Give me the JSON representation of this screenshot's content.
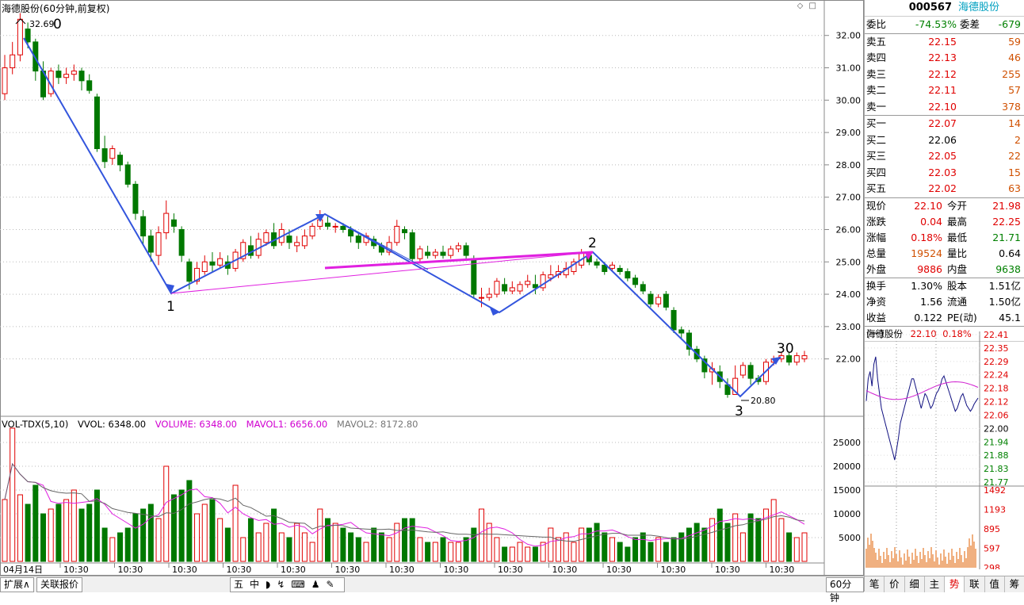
{
  "chart_title": "海德股份(60分钟,前复权)",
  "price_axis": {
    "ticks": [
      "32.00",
      "31.00",
      "30.00",
      "29.00",
      "28.00",
      "27.00",
      "26.00",
      "25.00",
      "24.00",
      "23.00",
      "22.00"
    ],
    "min": 20.3,
    "max": 32.9
  },
  "volume_axis": {
    "ticks": [
      "25000",
      "20000",
      "15000",
      "10000",
      "5000"
    ],
    "max": 28000
  },
  "annotations": {
    "high_label": "32.69",
    "low_label": "20.80",
    "wave0": "0",
    "wave1": "1",
    "wave2": "2",
    "wave3": "3",
    "wave30": "30"
  },
  "vol_header": {
    "name": "VOL-TDX(5,10)",
    "vvol": "VVOL: 6348.00",
    "volume": "VOLUME: 6348.00",
    "mavol1": "MAVOL1: 6656.00",
    "mavol2": "MAVOL2: 8172.80"
  },
  "time_axis": {
    "first": "04月14日",
    "tick": "10:30"
  },
  "bottom_tabs": {
    "expand": "扩展∧",
    "related": "关联报价",
    "period": "60分钟"
  },
  "sidebar": {
    "code": "000567",
    "name": "海德股份",
    "weibi_label": "委比",
    "weibi": "-74.53%",
    "weicha_label": "委差",
    "weicha": "-679",
    "sell": [
      {
        "label": "卖五",
        "price": "22.15",
        "vol": "59"
      },
      {
        "label": "卖四",
        "price": "22.13",
        "vol": "46"
      },
      {
        "label": "卖三",
        "price": "22.12",
        "vol": "255"
      },
      {
        "label": "卖二",
        "price": "22.11",
        "vol": "57"
      },
      {
        "label": "卖一",
        "price": "22.10",
        "vol": "378"
      }
    ],
    "buy": [
      {
        "label": "买一",
        "price": "22.07",
        "vol": "14"
      },
      {
        "label": "买二",
        "price": "22.06",
        "vol": "2"
      },
      {
        "label": "买三",
        "price": "22.05",
        "vol": "22"
      },
      {
        "label": "买四",
        "price": "22.03",
        "vol": "15"
      },
      {
        "label": "买五",
        "price": "22.02",
        "vol": "63"
      }
    ],
    "fund": [
      {
        "a": "现价",
        "b": "22.10",
        "c": "今开",
        "d": "21.98"
      },
      {
        "a": "涨跌",
        "b": "0.04",
        "c": "最高",
        "d": "22.25"
      },
      {
        "a": "涨幅",
        "b": "0.18%",
        "c": "最低",
        "d": "21.71"
      },
      {
        "a": "总量",
        "b": "19524",
        "c": "量比",
        "d": "0.64"
      },
      {
        "a": "外盘",
        "b": "9886",
        "c": "内盘",
        "d": "9638"
      }
    ],
    "fund2": [
      {
        "a": "换手",
        "b": "1.30%",
        "c": "股本",
        "d": "1.51亿"
      },
      {
        "a": "净资",
        "b": "1.56",
        "c": "流通",
        "d": "1.50亿"
      },
      {
        "a": "收益(一)",
        "b": "0.122",
        "c": "PE(动)",
        "d": "45.1"
      }
    ],
    "mini_title": "海德股份",
    "mini_price": "22.10",
    "mini_pct": "0.18%",
    "mini_ticks": [
      "22.41",
      "22.35",
      "22.29",
      "22.24",
      "22.18",
      "22.12",
      "22.06",
      "22.00",
      "21.94",
      "21.88",
      "21.83",
      "21.77"
    ],
    "mini_vol_ticks": [
      "1492",
      "1193",
      "895",
      "597",
      "298"
    ],
    "tabs": [
      "笔",
      "价",
      "细",
      "主",
      "势",
      "联",
      "值",
      "筹"
    ]
  },
  "colors": {
    "up": "#e00000",
    "down": "#007800",
    "wave": "#3355dd",
    "magenta": "#e020e0"
  },
  "chart_data": {
    "type": "candlestick",
    "candles": [
      [
        30.2,
        31.0,
        31.4,
        30.0
      ],
      [
        31.0,
        31.4,
        31.8,
        30.8
      ],
      [
        31.4,
        32.5,
        32.69,
        31.2
      ],
      [
        32.2,
        31.8,
        32.4,
        31.6
      ],
      [
        31.8,
        30.9,
        31.9,
        30.6
      ],
      [
        30.9,
        30.1,
        31.2,
        30.0
      ],
      [
        30.2,
        30.9,
        31.0,
        30.1
      ],
      [
        30.9,
        30.7,
        31.1,
        30.5
      ],
      [
        30.7,
        30.8,
        31.0,
        30.5
      ],
      [
        30.8,
        30.9,
        31.1,
        30.6
      ],
      [
        30.9,
        30.6,
        31.0,
        30.3
      ],
      [
        30.6,
        30.3,
        30.8,
        30.2
      ],
      [
        30.1,
        28.5,
        30.2,
        28.4
      ],
      [
        28.5,
        28.1,
        28.9,
        27.9
      ],
      [
        28.2,
        28.5,
        28.6,
        28.0
      ],
      [
        28.3,
        28.0,
        28.4,
        27.8
      ],
      [
        28.0,
        27.4,
        28.1,
        27.3
      ],
      [
        27.4,
        26.5,
        27.5,
        26.3
      ],
      [
        26.4,
        25.8,
        26.6,
        25.5
      ],
      [
        25.8,
        25.3,
        26.0,
        25.0
      ],
      [
        25.2,
        25.9,
        26.1,
        24.9
      ],
      [
        25.9,
        26.5,
        26.9,
        25.7
      ],
      [
        26.3,
        26.1,
        26.5,
        25.9
      ],
      [
        26.0,
        25.2,
        26.1,
        25.0
      ],
      [
        25.0,
        24.4,
        25.1,
        24.15
      ],
      [
        24.4,
        24.8,
        25.0,
        24.3
      ],
      [
        24.7,
        25.0,
        25.2,
        24.6
      ],
      [
        25.0,
        24.9,
        25.3,
        24.7
      ],
      [
        24.9,
        25.1,
        25.3,
        24.8
      ],
      [
        25.0,
        24.8,
        25.2,
        24.6
      ],
      [
        24.8,
        25.3,
        25.4,
        24.7
      ],
      [
        25.1,
        25.6,
        25.7,
        25.0
      ],
      [
        25.5,
        25.2,
        25.8,
        25.1
      ],
      [
        25.2,
        25.7,
        25.9,
        25.1
      ],
      [
        25.6,
        25.9,
        26.0,
        25.5
      ],
      [
        25.9,
        25.5,
        26.2,
        25.4
      ],
      [
        25.6,
        26.0,
        26.2,
        25.5
      ],
      [
        25.8,
        25.6,
        26.0,
        25.4
      ],
      [
        25.5,
        25.6,
        25.8,
        25.3
      ],
      [
        25.5,
        25.8,
        26.0,
        25.4
      ],
      [
        25.8,
        26.1,
        26.2,
        25.7
      ],
      [
        26.1,
        26.3,
        26.6,
        26.0
      ],
      [
        26.2,
        26.1,
        26.4,
        26.0
      ],
      [
        26.1,
        26.1,
        26.2,
        25.9
      ],
      [
        26.1,
        26.0,
        26.2,
        25.9
      ],
      [
        26.0,
        25.8,
        26.1,
        25.6
      ],
      [
        25.8,
        25.6,
        25.9,
        25.4
      ],
      [
        25.6,
        25.8,
        25.9,
        25.5
      ],
      [
        25.7,
        25.5,
        25.8,
        25.4
      ],
      [
        25.5,
        25.3,
        25.6,
        25.2
      ],
      [
        25.3,
        25.6,
        25.8,
        25.2
      ],
      [
        25.6,
        26.1,
        26.3,
        25.5
      ],
      [
        26.0,
        25.9,
        26.1,
        25.7
      ],
      [
        25.9,
        25.1,
        26.0,
        25.0
      ],
      [
        25.1,
        25.4,
        25.5,
        25.0
      ],
      [
        25.3,
        25.2,
        25.5,
        25.1
      ],
      [
        25.2,
        25.3,
        25.4,
        25.1
      ],
      [
        25.3,
        25.2,
        25.5,
        25.1
      ],
      [
        25.2,
        25.4,
        25.5,
        25.1
      ],
      [
        25.4,
        25.5,
        25.6,
        25.3
      ],
      [
        25.5,
        25.2,
        25.6,
        25.1
      ],
      [
        25.1,
        24.0,
        25.2,
        23.9
      ],
      [
        23.9,
        23.9,
        24.2,
        23.6
      ],
      [
        23.9,
        24.0,
        24.2,
        23.8
      ],
      [
        24.0,
        24.4,
        24.5,
        23.9
      ],
      [
        24.3,
        24.1,
        24.5,
        24.0
      ],
      [
        24.1,
        24.2,
        24.4,
        24.0
      ],
      [
        24.1,
        24.3,
        24.4,
        24.0
      ],
      [
        24.3,
        24.4,
        24.6,
        24.2
      ],
      [
        24.3,
        24.2,
        24.6,
        24.0
      ],
      [
        24.2,
        24.6,
        24.7,
        24.1
      ],
      [
        24.5,
        24.6,
        24.9,
        24.4
      ],
      [
        24.6,
        24.7,
        24.9,
        24.5
      ],
      [
        24.6,
        24.8,
        25.0,
        24.5
      ],
      [
        24.7,
        25.0,
        25.1,
        24.6
      ],
      [
        24.9,
        25.3,
        25.4,
        24.8
      ],
      [
        25.2,
        25.0,
        25.3,
        24.9
      ],
      [
        25.0,
        24.9,
        25.1,
        24.8
      ],
      [
        24.9,
        24.7,
        25.0,
        24.6
      ],
      [
        24.8,
        24.9,
        25.0,
        24.7
      ],
      [
        24.8,
        24.7,
        24.9,
        24.6
      ],
      [
        24.7,
        24.5,
        24.8,
        24.4
      ],
      [
        24.5,
        24.3,
        24.6,
        24.2
      ],
      [
        24.3,
        24.1,
        24.4,
        24.0
      ],
      [
        24.0,
        23.7,
        24.1,
        23.6
      ],
      [
        23.7,
        23.9,
        24.0,
        23.6
      ],
      [
        24.0,
        23.6,
        24.1,
        23.5
      ],
      [
        23.5,
        22.9,
        23.6,
        22.8
      ],
      [
        22.9,
        22.8,
        23.0,
        22.6
      ],
      [
        22.8,
        22.3,
        22.9,
        22.1
      ],
      [
        22.3,
        22.0,
        22.4,
        21.9
      ],
      [
        22.0,
        21.6,
        22.1,
        21.4
      ],
      [
        21.6,
        21.7,
        21.9,
        21.2
      ],
      [
        21.6,
        21.3,
        21.8,
        21.1
      ],
      [
        21.2,
        20.9,
        21.4,
        20.8
      ],
      [
        20.9,
        21.4,
        21.8,
        20.9
      ],
      [
        21.5,
        21.8,
        21.9,
        21.4
      ],
      [
        21.8,
        21.4,
        21.9,
        21.2
      ],
      [
        21.4,
        21.3,
        21.5,
        21.2
      ],
      [
        21.3,
        21.9,
        22.0,
        21.2
      ],
      [
        21.9,
        22.0,
        22.1,
        21.8
      ],
      [
        22.0,
        22.1,
        22.2,
        21.9
      ],
      [
        22.1,
        21.9,
        22.2,
        21.8
      ],
      [
        21.9,
        22.1,
        22.2,
        21.8
      ],
      [
        22.0,
        22.1,
        22.25,
        21.9
      ]
    ],
    "volumes": [
      13000,
      28000,
      14000,
      12000,
      16000,
      10000,
      11000,
      12000,
      13000,
      15000,
      11000,
      12000,
      15000,
      7000,
      5000,
      6000,
      7000,
      10000,
      11000,
      12000,
      9000,
      20000,
      14000,
      15000,
      17000,
      10000,
      12000,
      13000,
      9000,
      7000,
      16000,
      5000,
      9000,
      6000,
      8000,
      11000,
      6000,
      5000,
      8000,
      6000,
      4000,
      11000,
      9000,
      8000,
      7000,
      6000,
      5000,
      4000,
      7000,
      6000,
      5000,
      8000,
      9000,
      9000,
      5000,
      4000,
      4000,
      5000,
      4000,
      4000,
      5000,
      7000,
      11000,
      8000,
      5000,
      3000,
      3000,
      4000,
      3000,
      3000,
      4000,
      7000,
      5000,
      6000,
      4000,
      7000,
      7000,
      8000,
      6000,
      5000,
      4000,
      3000,
      5000,
      6000,
      4000,
      5000,
      4000,
      5000,
      6000,
      7000,
      8000,
      7000,
      9000,
      11000,
      8000,
      10000,
      6000,
      10000,
      9000,
      11000,
      13000,
      9000,
      6000,
      5000,
      6000
    ]
  }
}
